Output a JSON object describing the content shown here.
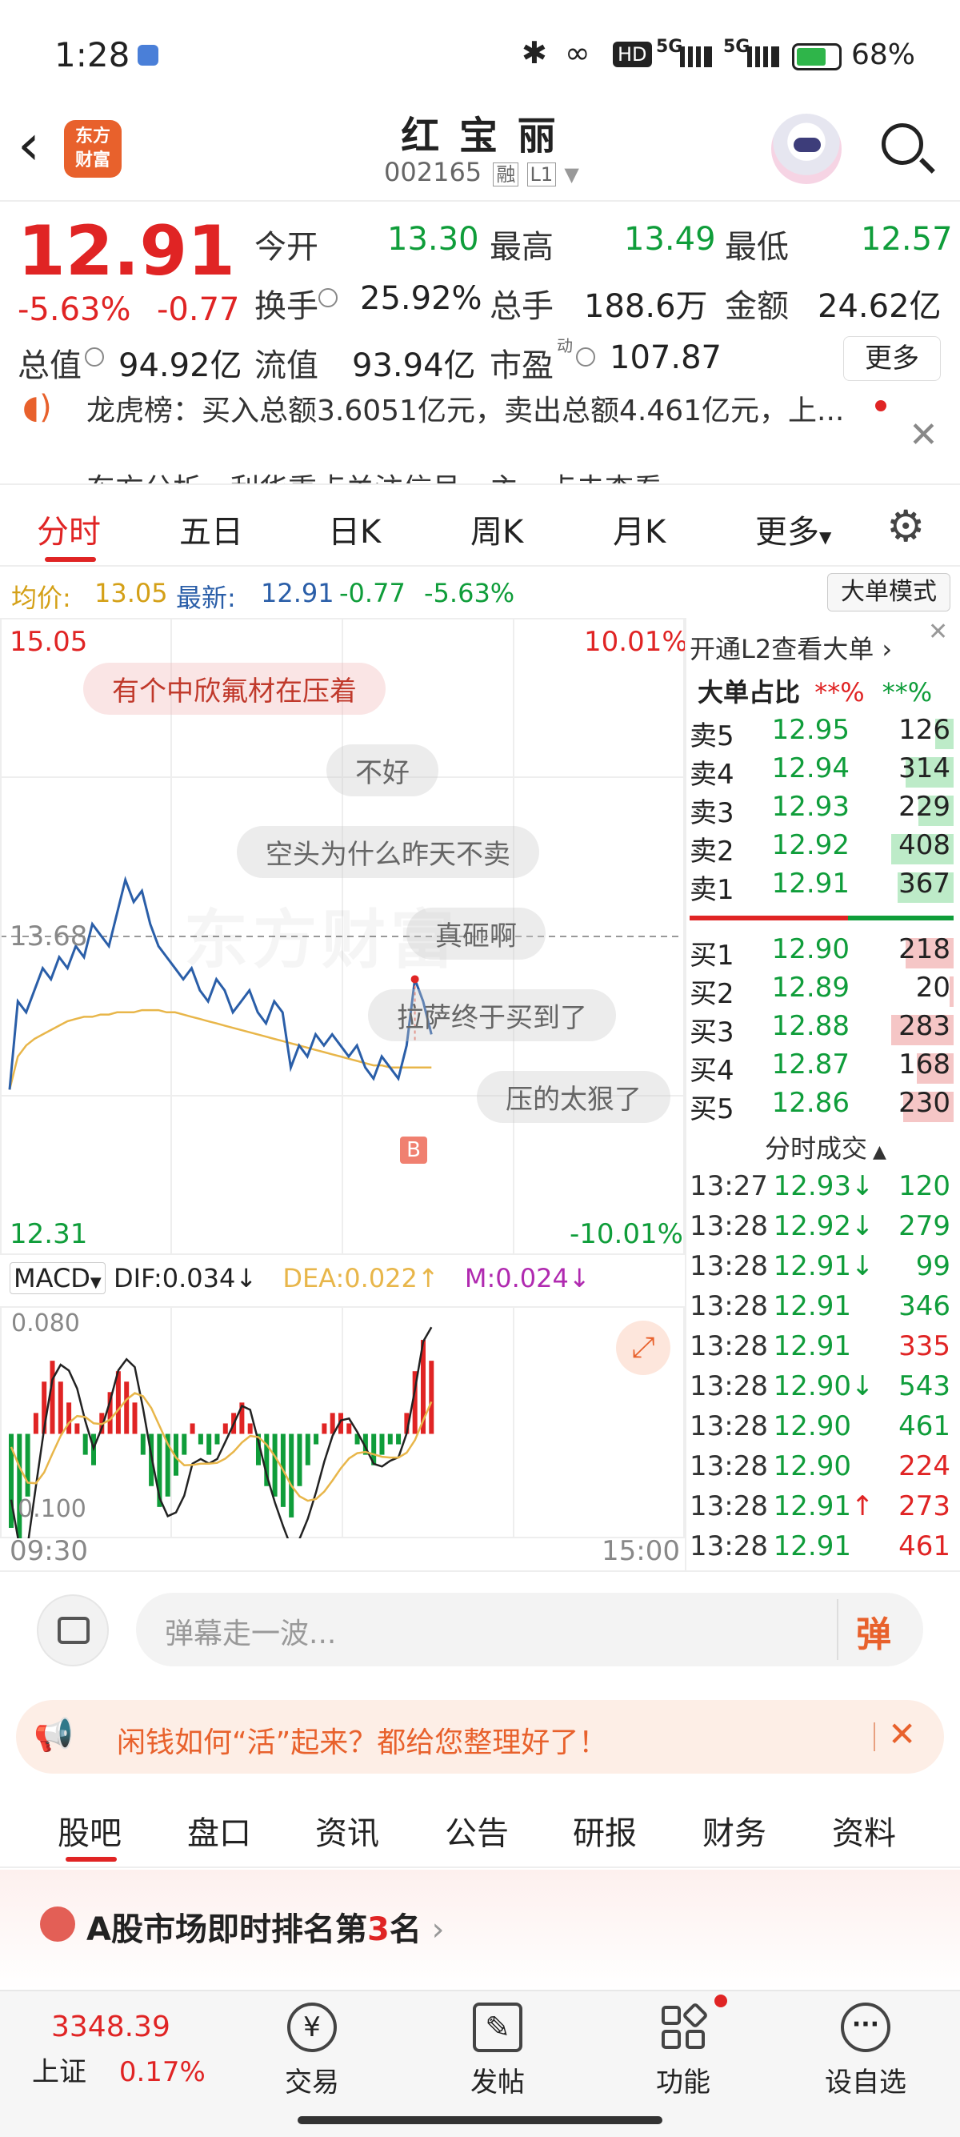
{
  "status": {
    "time": "1:28",
    "battery": "68%",
    "net1": "5G",
    "net2": "5G",
    "hd": "HD"
  },
  "header": {
    "title": "红 宝 丽",
    "code": "002165",
    "margin_tag": "融",
    "level_tag": "L1",
    "logo_line1": "东方",
    "logo_line2": "财富"
  },
  "quote": {
    "price": "12.91",
    "change_pct": "-5.63%",
    "change": "-0.77",
    "open_label": "今开",
    "open": "13.30",
    "high_label": "最高",
    "high": "13.49",
    "low_label": "最低",
    "low": "12.57",
    "turnover_label": "换手",
    "turnover": "25.92%",
    "volume_label": "总手",
    "volume": "188.6万",
    "amount_label": "金额",
    "amount": "24.62亿",
    "mktcap_label": "总值",
    "mktcap": "94.92亿",
    "float_label": "流值",
    "float": "93.94亿",
    "pe_label": "市盈",
    "pe_sup": "动",
    "pe": "107.87",
    "more_button": "更多"
  },
  "news": {
    "line1": "龙虎榜：买入总额3.6051亿元，卖出总额4.461亿元，上...",
    "line2": "东方分析，利华重点关注信号，主…点击查看"
  },
  "tabs": {
    "items": [
      "分时",
      "五日",
      "日K",
      "周K",
      "月K",
      "更多"
    ],
    "active": "分时"
  },
  "info_bar": {
    "avg_label": "均价:",
    "avg": "13.05",
    "latest_label": "最新:",
    "latest": "12.91",
    "change": "-0.77",
    "pct": "-5.63%",
    "bigorder_button": "大单模式"
  },
  "chart": {
    "y_top": "15.05",
    "pct_top": "10.01%",
    "mid": "13.68",
    "y_bottom": "12.31",
    "pct_bottom": "-10.01%",
    "x_start": "09:30",
    "x_end": "15:00",
    "watermark": "东方财富",
    "buy_marker": "B",
    "macd_name": "MACD",
    "dif": "DIF:0.034",
    "dea": "DEA:0.022",
    "m": "M:0.024",
    "macd_top": "0.080",
    "macd_bottom": "0.100"
  },
  "chart_data": {
    "type": "line",
    "ylim": [
      12.31,
      15.05
    ],
    "series": [
      {
        "values": [
          12.95,
          13.35,
          13.3,
          13.4,
          13.5,
          13.45,
          13.55,
          13.5,
          13.6,
          13.55,
          13.7,
          13.65,
          13.6,
          13.75,
          13.9,
          13.8,
          13.85,
          13.7,
          13.6,
          13.55,
          13.5,
          13.45,
          13.5,
          13.4,
          13.35,
          13.45,
          13.4,
          13.3,
          13.35,
          13.4,
          13.3,
          13.25,
          13.35,
          13.3,
          13.05,
          13.15,
          13.1,
          13.2,
          13.15,
          13.2,
          13.15,
          13.1,
          13.15,
          13.05,
          13.0,
          13.1,
          13.05,
          13.0,
          13.15,
          13.45,
          13.35,
          13.2
        ]
      },
      {
        "values": [
          12.95,
          13.1,
          13.15,
          13.18,
          13.2,
          13.22,
          13.24,
          13.26,
          13.27,
          13.28,
          13.28,
          13.29,
          13.29,
          13.3,
          13.3,
          13.3,
          13.31,
          13.31,
          13.31,
          13.3,
          13.3,
          13.29,
          13.28,
          13.27,
          13.26,
          13.25,
          13.24,
          13.23,
          13.22,
          13.21,
          13.2,
          13.19,
          13.18,
          13.17,
          13.16,
          13.15,
          13.14,
          13.13,
          13.12,
          13.11,
          13.1,
          13.09,
          13.08,
          13.07,
          13.06,
          13.06,
          13.05,
          13.05,
          13.05,
          13.05,
          13.05,
          13.05
        ]
      }
    ],
    "macd_hist": [
      -0.09,
      -0.1,
      -0.06,
      0.02,
      0.05,
      0.07,
      0.05,
      0.03,
      0.01,
      -0.02,
      -0.03,
      0.02,
      0.04,
      0.06,
      0.05,
      0.03,
      -0.02,
      -0.05,
      -0.07,
      -0.06,
      -0.04,
      -0.02,
      0.01,
      -0.01,
      -0.02,
      -0.01,
      0.01,
      0.02,
      0.03,
      0.01,
      -0.03,
      -0.05,
      -0.06,
      -0.07,
      -0.08,
      -0.05,
      -0.03,
      -0.01,
      0.01,
      0.02,
      0.02,
      0.01,
      -0.01,
      -0.02,
      -0.03,
      -0.02,
      -0.01,
      -0.01,
      0.02,
      0.06,
      0.09,
      0.07
    ]
  },
  "orderbook": {
    "l2_text": "开通L2查看大单",
    "ratio_label": "大单占比",
    "ratio_red": "**%",
    "ratio_green": "**%",
    "asks": [
      {
        "label": "卖5",
        "price": "12.95",
        "vol": "126",
        "bar": 0.3
      },
      {
        "label": "卖4",
        "price": "12.94",
        "vol": "314",
        "bar": 0.77
      },
      {
        "label": "卖3",
        "price": "12.93",
        "vol": "229",
        "bar": 0.56
      },
      {
        "label": "卖2",
        "price": "12.92",
        "vol": "408",
        "bar": 1.0
      },
      {
        "label": "卖1",
        "price": "12.91",
        "vol": "367",
        "bar": 0.9
      }
    ],
    "bids": [
      {
        "label": "买1",
        "price": "12.90",
        "vol": "218",
        "bar": 0.77
      },
      {
        "label": "买2",
        "price": "12.89",
        "vol": "20",
        "bar": 0.07
      },
      {
        "label": "买3",
        "price": "12.88",
        "vol": "283",
        "bar": 1.0
      },
      {
        "label": "买4",
        "price": "12.87",
        "vol": "168",
        "bar": 0.59
      },
      {
        "label": "买5",
        "price": "12.86",
        "vol": "230",
        "bar": 0.81
      }
    ],
    "trades_title": "分时成交",
    "trades": [
      {
        "t": "13:27",
        "p": "12.93",
        "arrow": "↓",
        "pc": "green",
        "v": "120",
        "vc": "green"
      },
      {
        "t": "13:28",
        "p": "12.92",
        "arrow": "↓",
        "pc": "green",
        "v": "279",
        "vc": "green"
      },
      {
        "t": "13:28",
        "p": "12.91",
        "arrow": "↓",
        "pc": "green",
        "v": "99",
        "vc": "green"
      },
      {
        "t": "13:28",
        "p": "12.91",
        "arrow": "",
        "pc": "green",
        "v": "346",
        "vc": "green"
      },
      {
        "t": "13:28",
        "p": "12.91",
        "arrow": "",
        "pc": "green",
        "v": "335",
        "vc": "red"
      },
      {
        "t": "13:28",
        "p": "12.90",
        "arrow": "↓",
        "pc": "green",
        "v": "543",
        "vc": "green"
      },
      {
        "t": "13:28",
        "p": "12.90",
        "arrow": "",
        "pc": "green",
        "v": "461",
        "vc": "green"
      },
      {
        "t": "13:28",
        "p": "12.90",
        "arrow": "",
        "pc": "green",
        "v": "224",
        "vc": "red"
      },
      {
        "t": "13:28",
        "p": "12.91",
        "arrow": "↑",
        "pc": "green",
        "v": "273",
        "vc": "red"
      },
      {
        "t": "13:28",
        "p": "12.91",
        "arrow": "",
        "pc": "green",
        "v": "461",
        "vc": "red"
      }
    ]
  },
  "danmaku": {
    "bubbles": [
      "有个中欣氟材在压着",
      "不好",
      "空头为什么昨天不卖",
      "真砸啊",
      "拉萨终于买到了",
      "压的太狠了"
    ],
    "input_placeholder": "弹幕走一波...",
    "send_button": "弹"
  },
  "banner": {
    "text": "闲钱如何“活”起来？都给您整理好了！"
  },
  "bottom_tabs": {
    "items": [
      "股吧",
      "盘口",
      "资讯",
      "公告",
      "研报",
      "财务",
      "资料"
    ],
    "active": "股吧"
  },
  "ranking": {
    "prefix": "A股市场即时排名第",
    "rank": "3",
    "suffix": "名"
  },
  "navbar": {
    "index_value": "3348.39",
    "index_name": "上证",
    "index_pct": "0.17%",
    "items": [
      {
        "label": "交易",
        "icon": "yuan-exchange-icon"
      },
      {
        "label": "发帖",
        "icon": "edit-icon"
      },
      {
        "label": "功能",
        "icon": "grid-icon"
      },
      {
        "label": "设自选",
        "icon": "more-dots-icon"
      }
    ]
  },
  "colors": {
    "up": "#e02424",
    "down": "#0f9d3a",
    "accent": "#e8612c",
    "price_line": "#2a5ea8",
    "avg_line": "#e8b64a"
  }
}
